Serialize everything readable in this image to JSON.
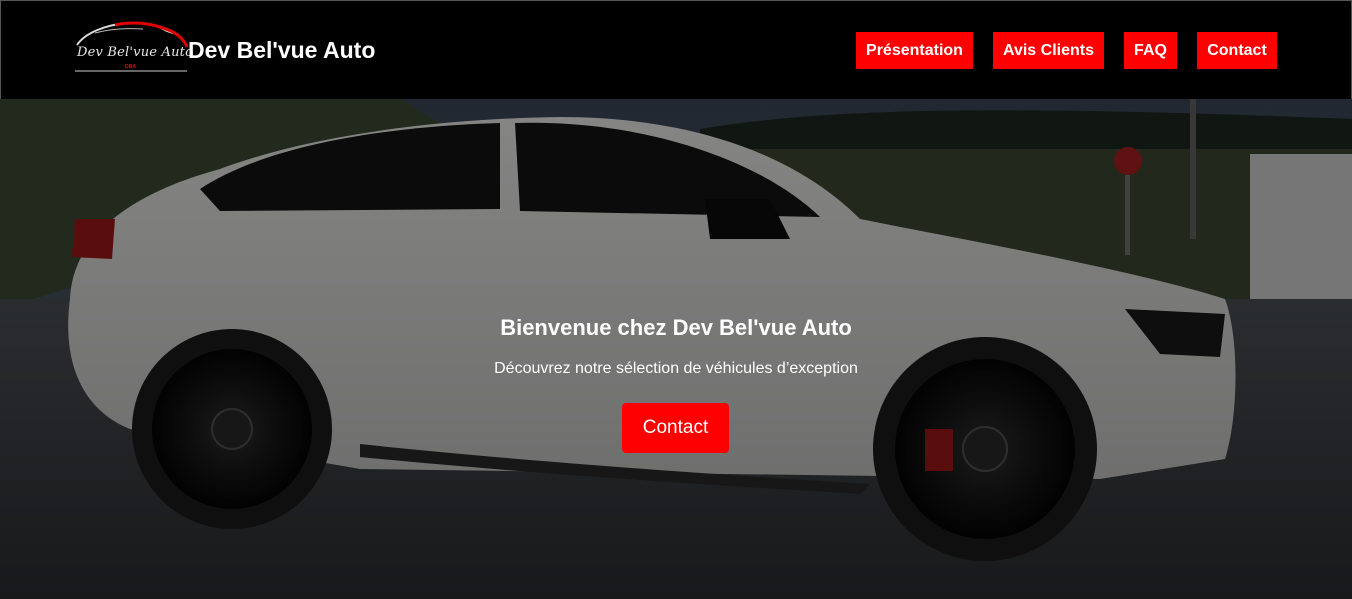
{
  "header": {
    "logo_text": "Dev Bel'vue Auto",
    "logo_subtext": "DBA",
    "brand_name": "Dev Bel'vue Auto"
  },
  "nav": {
    "items": [
      {
        "label": "Présentation"
      },
      {
        "label": "Avis Clients"
      },
      {
        "label": "FAQ"
      },
      {
        "label": "Contact"
      }
    ]
  },
  "hero": {
    "title": "Bienvenue chez Dev Bel'vue Auto",
    "subtitle": "Découvrez notre sélection de véhicules d’exception",
    "cta_label": "Contact"
  },
  "colors": {
    "accent": "#ff0000",
    "header_bg": "#000000",
    "text": "#ffffff"
  }
}
